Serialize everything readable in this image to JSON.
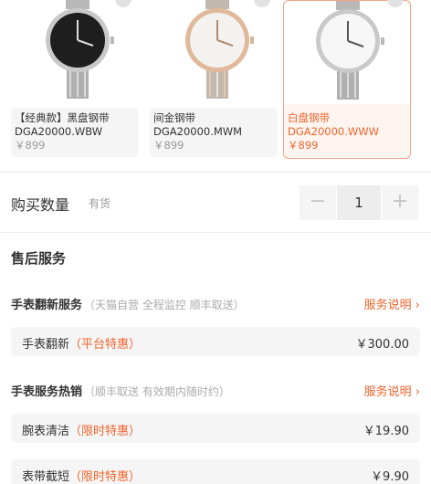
{
  "variants": [
    {
      "name": "【经典款】黑盘钢带",
      "model": "DGA20000.WBW",
      "price": "￥899",
      "selected": false
    },
    {
      "name": "间金钢带",
      "model": "DGA20000.MWM",
      "price": "￥899",
      "selected": false
    },
    {
      "name": "白盘钢带",
      "model": "DGA20000.WWW",
      "price": "￥899",
      "selected": true
    }
  ],
  "quantity": {
    "label": "购买数量",
    "stock": "有货",
    "minus": "−",
    "value": "1",
    "plus": "+"
  },
  "after_sales": {
    "title": "售后服务",
    "groups": [
      {
        "title": "手表翻新服务",
        "note": "（天猫自营  全程监控  顺丰取送）",
        "link": "服务说明",
        "items": [
          {
            "label": "手表翻新",
            "tag": "（平台特惠）",
            "amount": "￥300.00"
          }
        ]
      },
      {
        "title": "手表服务热销",
        "note": "（顺丰取送  有效期内随时约）",
        "link": "服务说明",
        "items": [
          {
            "label": "腕表清洁",
            "tag": "（限时特惠）",
            "amount": "￥19.90"
          },
          {
            "label": "表带截短",
            "tag": "（限时特惠）",
            "amount": "￥9.90"
          }
        ]
      }
    ]
  },
  "colors": {
    "accent": "#f0642d",
    "selected_border": "#f0a587",
    "muted": "#999999",
    "panel": "#f5f5f5"
  },
  "icons": {
    "chevron": "chevron-right-icon",
    "zoom": "zoom-icon"
  }
}
